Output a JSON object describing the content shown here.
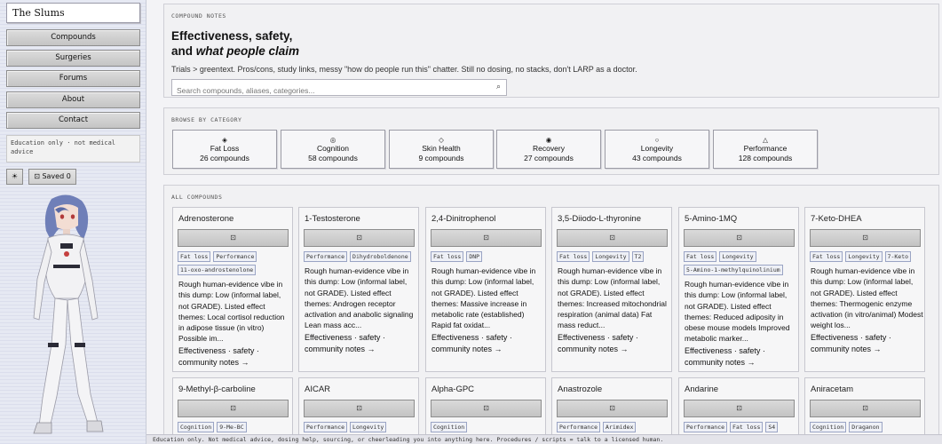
{
  "sidebar": {
    "brand": "The Slums",
    "nav": [
      "Compounds",
      "Surgeries",
      "Forums",
      "About",
      "Contact"
    ],
    "edu_note": "Education only · not medical advice",
    "theme_icon": "☀",
    "saved_icon": "⊡",
    "saved_label": "Saved 0"
  },
  "hero": {
    "label": "COMPOUND NOTES",
    "title_line1": "Effectiveness, safety,",
    "title_line2_plain": "and ",
    "title_line2_em": "what people claim",
    "desc": "Trials > greentext. Pros/cons, study links, messy \"how do people run this\" chatter. Still no dosing, no stacks, don't LARP as a doctor.",
    "search_placeholder": "Search compounds, aliases, categories...",
    "search_icon": "⌕"
  },
  "categories": {
    "label": "BROWSE BY CATEGORY",
    "items": [
      {
        "icon": "◈",
        "name": "Fat Loss",
        "count": "26 compounds"
      },
      {
        "icon": "◎",
        "name": "Cognition",
        "count": "58 compounds"
      },
      {
        "icon": "◇",
        "name": "Skin Health",
        "count": "9 compounds"
      },
      {
        "icon": "◉",
        "name": "Recovery",
        "count": "27 compounds"
      },
      {
        "icon": "○",
        "name": "Longevity",
        "count": "43 compounds"
      },
      {
        "icon": "△",
        "name": "Performance",
        "count": "128 compounds"
      }
    ]
  },
  "compounds": {
    "label": "ALL COMPOUNDS",
    "save_icon": "⊡",
    "items": [
      {
        "name": "Adrenosterone",
        "tags": [
          "Fat loss",
          "Performance",
          "11-oxo-androstenolone"
        ],
        "desc": "Rough human-evidence vibe in this dump: Low (informal label, not GRADE). Listed effect themes: Local cortisol reduction in adipose tissue (in vitro) Possible im...",
        "cta": "Effectiveness · safety · community notes →"
      },
      {
        "name": "1-Testosterone",
        "tags": [
          "Performance",
          "Dihydroboldenone"
        ],
        "desc": "Rough human-evidence vibe in this dump: Low (informal label, not GRADE). Listed effect themes: Androgen receptor activation and anabolic signaling Lean mass acc...",
        "cta": "Effectiveness · safety · community notes →"
      },
      {
        "name": "2,4-Dinitrophenol",
        "tags": [
          "Fat loss",
          "DNP"
        ],
        "desc": "Rough human-evidence vibe in this dump: Low (informal label, not GRADE). Listed effect themes: Massive increase in metabolic rate (established) Rapid fat oxidat...",
        "cta": "Effectiveness · safety · community notes →"
      },
      {
        "name": "3,5-Diiodo-L-thyronine",
        "tags": [
          "Fat loss",
          "Longevity",
          "T2"
        ],
        "desc": "Rough human-evidence vibe in this dump: Low (informal label, not GRADE). Listed effect themes: Increased mitochondrial respiration (animal data) Fat mass reduct...",
        "cta": "Effectiveness · safety · community notes →"
      },
      {
        "name": "5-Amino-1MQ",
        "tags": [
          "Fat loss",
          "Longevity",
          "5-Amino-1-methylquinolinium"
        ],
        "desc": "Rough human-evidence vibe in this dump: Low (informal label, not GRADE). Listed effect themes: Reduced adiposity in obese mouse models Improved metabolic marker...",
        "cta": "Effectiveness · safety · community notes →"
      },
      {
        "name": "7-Keto-DHEA",
        "tags": [
          "Fat loss",
          "Longevity",
          "7-Keto"
        ],
        "desc": "Rough human-evidence vibe in this dump: Low (informal label, not GRADE). Listed effect themes: Thermogenic enzyme activation (in vitro/animal) Modest weight los...",
        "cta": "Effectiveness · safety · community notes →"
      },
      {
        "name": "9-Methyl-β-carboline",
        "tags": [
          "Cognition",
          "9-Me-BC"
        ],
        "desc": "",
        "cta": ""
      },
      {
        "name": "AICAR",
        "tags": [
          "Performance",
          "Longevity"
        ],
        "desc": "",
        "cta": ""
      },
      {
        "name": "Alpha-GPC",
        "tags": [
          "Cognition"
        ],
        "desc": "",
        "cta": ""
      },
      {
        "name": "Anastrozole",
        "tags": [
          "Performance",
          "Arimidex"
        ],
        "desc": "",
        "cta": ""
      },
      {
        "name": "Andarine",
        "tags": [
          "Performance",
          "Fat loss",
          "S4"
        ],
        "desc": "",
        "cta": ""
      },
      {
        "name": "Aniracetam",
        "tags": [
          "Cognition",
          "Draganon"
        ],
        "desc": "",
        "cta": ""
      }
    ]
  },
  "footer": {
    "text": "Education only. Not medical advice, dosing help, sourcing, or cheerleading you into anything here. Procedures / scripts = talk to a licensed human."
  }
}
